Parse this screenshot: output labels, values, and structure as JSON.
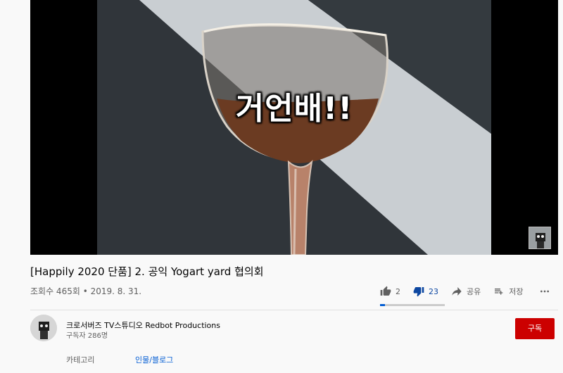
{
  "video": {
    "caption": "거언배!!",
    "title": "[Happily 2020 단품] 2. 공익 Yogart yard 협의회",
    "views": "조회수 465회",
    "separator": " • ",
    "date": "2019. 8. 31."
  },
  "actions": {
    "like_count": "2",
    "dislike_count": "23",
    "share_label": "공유",
    "save_label": "저장",
    "like_ratio": 0.08
  },
  "channel": {
    "name": "크로서버즈 TV스튜디오 Redbot Productions",
    "subscribers": "구독자 286명",
    "subscribe_label": "구독"
  },
  "category": {
    "label": "카테고리",
    "value": "인물/블로그"
  },
  "colors": {
    "subscribe_red": "#cc0000",
    "link_blue": "#065fd4",
    "dislike_active": "#0d47a1"
  },
  "icons": [
    "thumb-up-icon",
    "thumb-down-icon",
    "share-icon",
    "playlist-add-icon",
    "more-icon"
  ]
}
